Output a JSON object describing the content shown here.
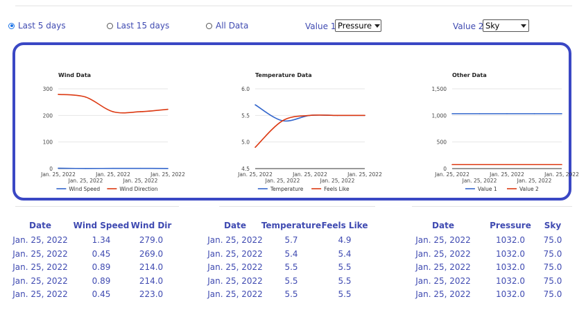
{
  "filters": {
    "radios": [
      {
        "label": "Last 5 days",
        "checked": true
      },
      {
        "label": "Last 15 days",
        "checked": false
      },
      {
        "label": "All Data",
        "checked": false
      }
    ],
    "value1": {
      "label": "Value 1",
      "selected": "Pressure"
    },
    "value2": {
      "label": "Value 2",
      "selected": "Sky"
    }
  },
  "colors": {
    "accent": "#3f4ab1",
    "border": "#3a47c4",
    "series_blue": "#3366cc",
    "series_red": "#dc3912"
  },
  "chart_data": [
    {
      "type": "line",
      "title": "Wind Data",
      "x": [
        "Jan. 25, 2022",
        "Jan. 25, 2022",
        "Jan. 25, 2022",
        "Jan. 25, 2022",
        "Jan. 25, 2022"
      ],
      "x_tick_labels": [
        "Jan. 25, 2022",
        "Jan. 25, 2022",
        "Jan. 25, 2022",
        "Jan. 25, 2022",
        "Jan. 25, 2022"
      ],
      "y_ticks": [
        "0",
        "100",
        "200",
        "300"
      ],
      "ylim": [
        0,
        300
      ],
      "series": [
        {
          "name": "Wind Speed",
          "color": "#3366cc",
          "values": [
            1.34,
            0.45,
            0.89,
            0.89,
            0.45
          ]
        },
        {
          "name": "Wind Direction",
          "color": "#dc3912",
          "values": [
            279.0,
            269.0,
            214.0,
            214.0,
            223.0
          ]
        }
      ],
      "legend": "bottom"
    },
    {
      "type": "line",
      "title": "Temperature Data",
      "x": [
        "Jan. 25, 2022",
        "Jan. 25, 2022",
        "Jan. 25, 2022",
        "Jan. 25, 2022",
        "Jan. 25, 2022"
      ],
      "x_tick_labels": [
        "Jan. 25, 2022",
        "Jan. 25, 2022",
        "Jan. 25, 2022",
        "Jan. 25, 2022",
        "Jan. 25, 2022"
      ],
      "y_ticks": [
        "4.5",
        "5.0",
        "5.5",
        "6.0"
      ],
      "ylim": [
        4.5,
        6.0
      ],
      "series": [
        {
          "name": "Temperature",
          "color": "#3366cc",
          "values": [
            5.7,
            5.4,
            5.5,
            5.5,
            5.5
          ]
        },
        {
          "name": "Feels Like",
          "color": "#dc3912",
          "values": [
            4.9,
            5.4,
            5.5,
            5.5,
            5.5
          ]
        }
      ],
      "legend": "bottom"
    },
    {
      "type": "line",
      "title": "Other Data",
      "x": [
        "Jan. 25, 2022",
        "Jan. 25, 2022",
        "Jan. 25, 2022",
        "Jan. 25, 2022",
        "Jan. 25, 2022"
      ],
      "x_tick_labels": [
        "Jan. 25, 2022",
        "Jan. 25, 2022",
        "Jan. 25, 2022",
        "Jan. 25, 2022",
        "Jan. 25, 2022"
      ],
      "y_ticks": [
        "0",
        "500",
        "1,000",
        "1,500"
      ],
      "ylim": [
        0,
        1500
      ],
      "series": [
        {
          "name": "Value 1",
          "color": "#3366cc",
          "values": [
            1032.0,
            1032.0,
            1032.0,
            1032.0,
            1032.0
          ]
        },
        {
          "name": "Value 2",
          "color": "#dc3912",
          "values": [
            75.0,
            75.0,
            75.0,
            75.0,
            75.0
          ]
        }
      ],
      "legend": "bottom"
    }
  ],
  "tables": [
    {
      "headers": [
        "Date",
        "Wind Speed",
        "Wind Dir"
      ],
      "rows": [
        [
          "Jan. 25, 2022",
          "1.34",
          "279.0"
        ],
        [
          "Jan. 25, 2022",
          "0.45",
          "269.0"
        ],
        [
          "Jan. 25, 2022",
          "0.89",
          "214.0"
        ],
        [
          "Jan. 25, 2022",
          "0.89",
          "214.0"
        ],
        [
          "Jan. 25, 2022",
          "0.45",
          "223.0"
        ]
      ]
    },
    {
      "headers": [
        "Date",
        "Temperature",
        "Feels Like"
      ],
      "rows": [
        [
          "Jan. 25, 2022",
          "5.7",
          "4.9"
        ],
        [
          "Jan. 25, 2022",
          "5.4",
          "5.4"
        ],
        [
          "Jan. 25, 2022",
          "5.5",
          "5.5"
        ],
        [
          "Jan. 25, 2022",
          "5.5",
          "5.5"
        ],
        [
          "Jan. 25, 2022",
          "5.5",
          "5.5"
        ]
      ]
    },
    {
      "headers": [
        "Date",
        "Pressure",
        "Sky"
      ],
      "rows": [
        [
          "Jan. 25, 2022",
          "1032.0",
          "75.0"
        ],
        [
          "Jan. 25, 2022",
          "1032.0",
          "75.0"
        ],
        [
          "Jan. 25, 2022",
          "1032.0",
          "75.0"
        ],
        [
          "Jan. 25, 2022",
          "1032.0",
          "75.0"
        ],
        [
          "Jan. 25, 2022",
          "1032.0",
          "75.0"
        ]
      ]
    }
  ]
}
